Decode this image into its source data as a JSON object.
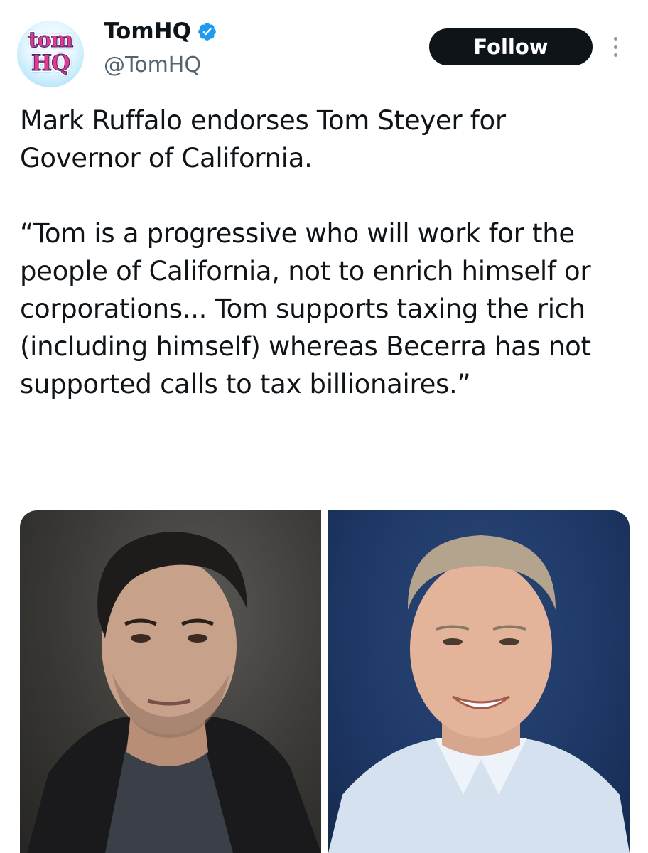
{
  "author": {
    "display_name": "TomHQ",
    "handle": "@TomHQ",
    "avatar_text": [
      "tom",
      "HQ"
    ],
    "verified": true
  },
  "actions": {
    "follow_label": "Follow",
    "more_icon": "more-vertical-icon"
  },
  "tweet": {
    "paragraphs": [
      "Mark Ruffalo endorses Tom Steyer for Governor of California.",
      "“Tom is a progressive who will work for the people of California, not to enrich himself or corporations... Tom supports taxing the rich (including himself) whereas Becerra has not supported calls to tax billionaires.”"
    ]
  },
  "media": {
    "count": 2
  },
  "colors": {
    "verified_blue": "#1d9bf0",
    "follow_bg": "#0f1419",
    "handle_gray": "#536471"
  }
}
